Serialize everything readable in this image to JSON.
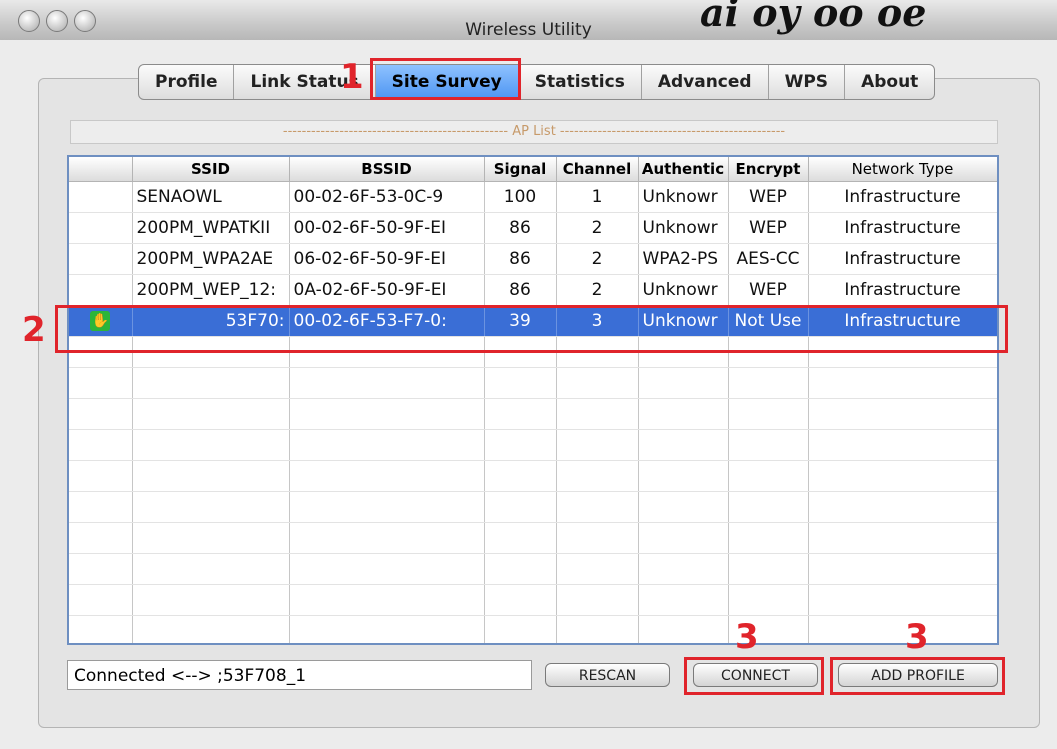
{
  "window": {
    "title": "Wireless Utility"
  },
  "overlay_text": "ai   oy oo  oe",
  "tabs": [
    {
      "label": "Profile",
      "active": false
    },
    {
      "label": "Link Status",
      "active": false
    },
    {
      "label": "Site Survey",
      "active": true
    },
    {
      "label": "Statistics",
      "active": false
    },
    {
      "label": "Advanced",
      "active": false
    },
    {
      "label": "WPS",
      "active": false
    },
    {
      "label": "About",
      "active": false
    }
  ],
  "ap_list": {
    "title": "------------------------------------------------ AP List ------------------------------------------------",
    "columns": [
      "",
      "SSID",
      "BSSID",
      "Signal",
      "Channel",
      "Authentic",
      "Encrypt",
      "Network Type"
    ],
    "rows": [
      {
        "icon": "",
        "ssid": "SENAOWL",
        "bssid": "00-02-6F-53-0C-9",
        "signal": "100",
        "channel": "1",
        "auth": "Unknowr",
        "encrypt": "WEP",
        "network_type": "Infrastructure"
      },
      {
        "icon": "",
        "ssid": "200PM_WPATKII",
        "bssid": "00-02-6F-50-9F-EI",
        "signal": "86",
        "channel": "2",
        "auth": "Unknowr",
        "encrypt": "WEP",
        "network_type": "Infrastructure"
      },
      {
        "icon": "",
        "ssid": "200PM_WPA2AE",
        "bssid": "06-02-6F-50-9F-EI",
        "signal": "86",
        "channel": "2",
        "auth": "WPA2-PS",
        "encrypt": "AES-CC",
        "network_type": "Infrastructure"
      },
      {
        "icon": "",
        "ssid": "200PM_WEP_12:",
        "bssid": "0A-02-6F-50-9F-EI",
        "signal": "86",
        "channel": "2",
        "auth": "Unknowr",
        "encrypt": "WEP",
        "network_type": "Infrastructure"
      },
      {
        "icon": "connected-icon",
        "ssid": "53F70:",
        "bssid": "00-02-6F-53-F7-0:",
        "signal": "39",
        "channel": "3",
        "auth": "Unknowr",
        "encrypt": "Not Use",
        "network_type": "Infrastructure",
        "selected": true
      }
    ],
    "empty_rows": 10
  },
  "status": {
    "text": "Connected <--> ;53F708_1"
  },
  "buttons": {
    "rescan": "RESCAN",
    "connect": "CONNECT",
    "add_profile": "ADD PROFILE"
  },
  "callouts": {
    "tab": "1",
    "row": "2",
    "connect": "3",
    "add_profile": "3"
  },
  "colors": {
    "callout": "#e0242b",
    "selection": "#3a6ed6",
    "active_tab": "#4d95f2"
  }
}
